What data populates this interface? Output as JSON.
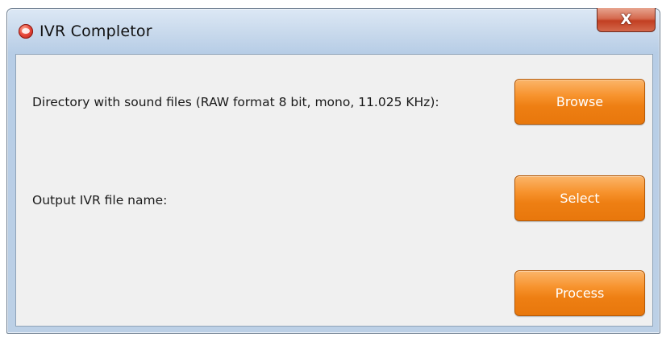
{
  "window": {
    "title": "IVR Completor",
    "close_label": "X"
  },
  "form": {
    "directory_label": "Directory with sound files (RAW format 8 bit, mono, 11.025 KHz):",
    "browse_label": "Browse",
    "output_label": "Output IVR file name:",
    "select_label": "Select",
    "process_label": "Process"
  },
  "colors": {
    "button_orange": "#f28a1f",
    "titlebar_blue": "#c8d9ec",
    "close_red": "#c23f22"
  }
}
